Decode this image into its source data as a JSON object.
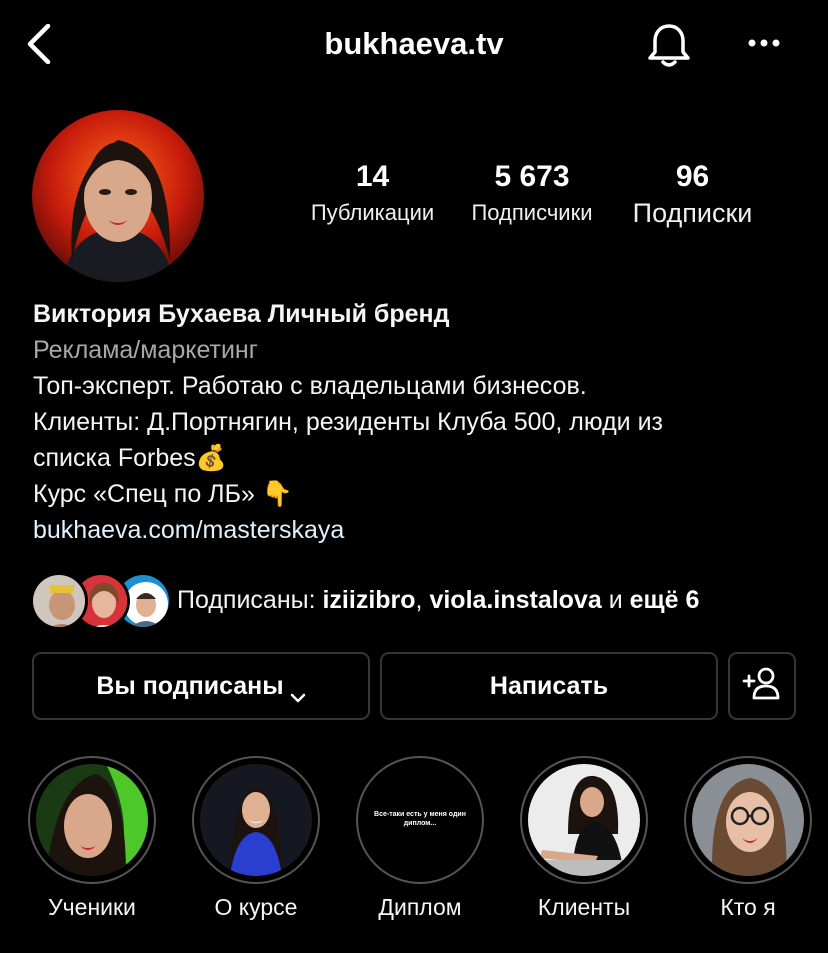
{
  "header": {
    "username": "bukhaeva.tv"
  },
  "stats": [
    {
      "value": "14",
      "label": "Публикации"
    },
    {
      "value": "5 673",
      "label": "Подписчики"
    },
    {
      "value": "96",
      "label": "Подписки"
    }
  ],
  "bio": {
    "name": "Виктория Бухаева Личный бренд",
    "category": "Реклама/маркетинг",
    "line1": "Топ-эксперт. Работаю с владельцами бизнесов.",
    "line2": "Клиенты: Д.Портнягин, резиденты Клуба 500, люди из",
    "line3": "списка Forbes",
    "line3_emoji": "💰",
    "line4": "Курс «Спец по ЛБ»",
    "line4_emoji": "👇",
    "link": "bukhaeva.com/masterskaya"
  },
  "followed_by": {
    "prefix": "Подписаны: ",
    "user1": "iziizibro",
    "sep": ", ",
    "user2": "viola.instalova",
    "mid": " и ",
    "more": "ещё 6"
  },
  "actions": {
    "following_label": "Вы подписаны",
    "message_label": "Написать"
  },
  "highlights": [
    {
      "label": "Ученики"
    },
    {
      "label": "О курсе"
    },
    {
      "label": "Диплом",
      "cover_text": "Все-таки есть у меня один диплом..."
    },
    {
      "label": "Клиенты"
    },
    {
      "label": "Кто я"
    }
  ],
  "colors": {
    "background": "#000000",
    "link": "#e0f1ff",
    "border": "#363636",
    "muted": "#a8a8a8"
  }
}
